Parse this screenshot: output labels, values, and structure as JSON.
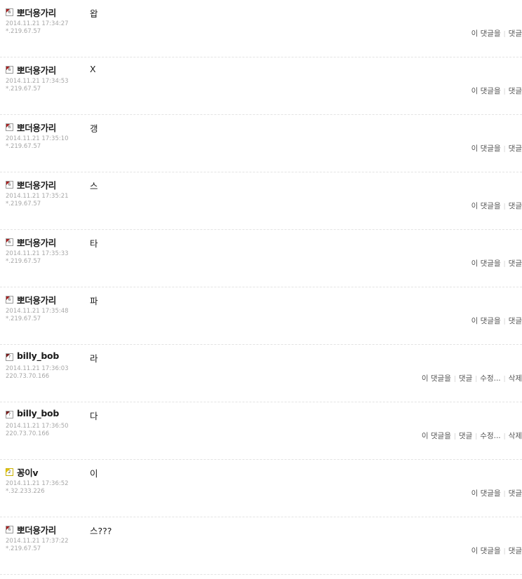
{
  "comments": [
    {
      "nick": "뽀더용가리",
      "level": "6",
      "icon": "level-6-icon",
      "time": "2014.11.21 17:34:27",
      "ip": "*.219.67.57",
      "text": "왑",
      "actions": [
        "이 댓글을",
        "댓글"
      ]
    },
    {
      "nick": "뽀더용가리",
      "level": "6",
      "icon": "level-6-icon",
      "time": "2014.11.21 17:34:53",
      "ip": "*.219.67.57",
      "text": "X",
      "actions": [
        "이 댓글을",
        "댓글"
      ]
    },
    {
      "nick": "뽀더용가리",
      "level": "6",
      "icon": "level-6-icon",
      "time": "2014.11.21 17:35:10",
      "ip": "*.219.67.57",
      "text": "갱",
      "actions": [
        "이 댓글을",
        "댓글"
      ]
    },
    {
      "nick": "뽀더용가리",
      "level": "6",
      "icon": "level-6-icon",
      "time": "2014.11.21 17:35:21",
      "ip": "*.219.67.57",
      "text": "스",
      "actions": [
        "이 댓글을",
        "댓글"
      ]
    },
    {
      "nick": "뽀더용가리",
      "level": "6",
      "icon": "level-6-icon",
      "time": "2014.11.21 17:35:33",
      "ip": "*.219.67.57",
      "text": "타",
      "actions": [
        "이 댓글을",
        "댓글"
      ]
    },
    {
      "nick": "뽀더용가리",
      "level": "6",
      "icon": "level-6-icon",
      "time": "2014.11.21 17:35:48",
      "ip": "*.219.67.57",
      "text": "파",
      "actions": [
        "이 댓글을",
        "댓글"
      ]
    },
    {
      "nick": "billy_bob",
      "level": "?",
      "icon": "level-unknown-icon",
      "time": "2014.11.21 17:36:03",
      "ip": "220.73.70.166",
      "text": "라",
      "actions": [
        "이 댓글을",
        "댓글",
        "수정...",
        "삭제"
      ]
    },
    {
      "nick": "billy_bob",
      "level": "?",
      "icon": "level-unknown-icon",
      "time": "2014.11.21 17:36:50",
      "ip": "220.73.70.166",
      "text": "다",
      "actions": [
        "이 댓글을",
        "댓글",
        "수정...",
        "삭제"
      ]
    },
    {
      "nick": "꽁이v",
      "level": "2",
      "icon": "level-2-icon",
      "time": "2014.11.21 17:36:52",
      "ip": "*.32.233.226",
      "text": "이",
      "actions": [
        "이 댓글을",
        "댓글"
      ]
    },
    {
      "nick": "뽀더용가리",
      "level": "6",
      "icon": "level-6-icon",
      "time": "2014.11.21 17:37:22",
      "ip": "*.219.67.57",
      "text": "스???",
      "actions": [
        "이 댓글을",
        "댓글"
      ]
    }
  ]
}
